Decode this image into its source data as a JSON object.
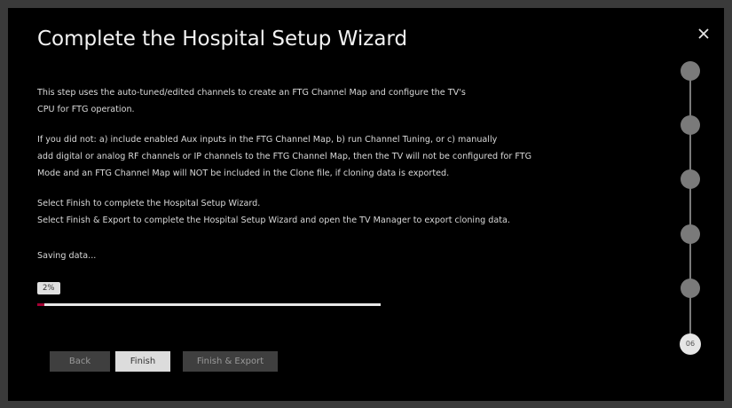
{
  "dialog": {
    "title": "Complete the Hospital Setup Wizard",
    "close_icon": "close-icon"
  },
  "body": {
    "paragraphs": [
      "This step uses the auto-tuned/edited channels to create an FTG Channel Map and configure the TV's\nCPU for FTG operation.",
      "If you did not: a) include enabled Aux inputs in the FTG Channel Map, b) run Channel Tuning, or c) manually\nadd digital or analog RF channels or IP channels to the FTG Channel Map, then the TV will not be configured for FTG\nMode and an FTG Channel Map will NOT be included in the Clone file, if cloning data is exported.",
      "Select Finish to complete the Hospital Setup Wizard.\nSelect Finish & Export to complete the Hospital Setup Wizard and open the TV Manager to export cloning data."
    ],
    "status_text": "Saving data..."
  },
  "progress": {
    "label": "2%",
    "percent": 2,
    "track_color": "#e8e8e8",
    "fill_color": "#a50034"
  },
  "buttons": {
    "back_label": "Back",
    "finish_label": "Finish",
    "finish_export_label": "Finish & Export"
  },
  "stepper": {
    "completed_steps": 5,
    "current_step_label": "06"
  },
  "colors": {
    "background": "#000000",
    "text": "#d9d9d9",
    "step_inactive": "#7a7a7a",
    "step_active": "#e6e6e6"
  }
}
